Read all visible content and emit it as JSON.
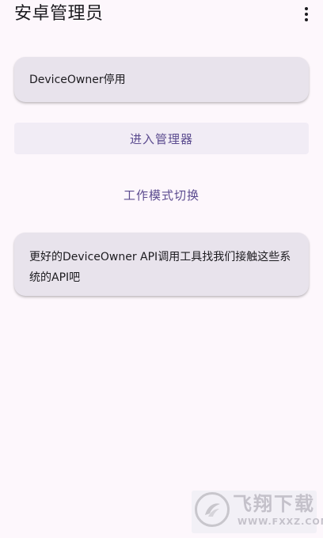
{
  "app_bar": {
    "title": "安卓管理员",
    "more_icon": "more-vert-icon"
  },
  "status_card": {
    "text": "DeviceOwner停用"
  },
  "buttons": {
    "enter_manager": "进入管理器",
    "switch_mode": "工作模式切换"
  },
  "tip_card": {
    "text": "更好的DeviceOwner API调用工具找我们接触这些系统的API吧"
  },
  "watermark": {
    "name": "飞翔下载",
    "url": "WWW.FXXZ.COM",
    "logo_icon": "fxxz-logo-icon"
  },
  "colors": {
    "background": "#fdf7fc",
    "card": "#e8e3ec",
    "accent_text": "#5b4b8f",
    "button_bg": "#f1ecf5"
  }
}
